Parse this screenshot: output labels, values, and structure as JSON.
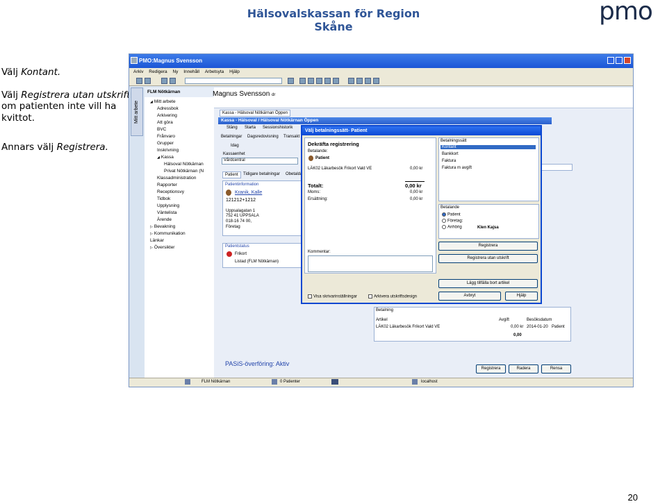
{
  "slide": {
    "title": "Hälsovalskassan för Region Skåne",
    "logo": "pmo",
    "page_number": "20",
    "instructions": {
      "line1_prefix": "Välj ",
      "line1_em": "Kontant.",
      "line2_prefix": "Välj ",
      "line2_em": "Registrera utan utskrift",
      "line3": "om patienten inte vill ha",
      "line4": "kvittot.",
      "line5_prefix": "Annars välj ",
      "line5_em": "Registrera."
    }
  },
  "app": {
    "title": "PMO:Magnus Svensson",
    "menu": [
      "Arkiv",
      "Redigera",
      "Ny",
      "Innehåll",
      "Arbetsyta",
      "Hjälp"
    ],
    "vertical_tab": "Mitt arbete",
    "tree_header": "FLM Nötkärnan",
    "user_name": "Magnus Svensson",
    "user_title": "dr",
    "tree": [
      {
        "label": "Mitt arbete",
        "indent": 0,
        "arrow": "◢"
      },
      {
        "label": "Adressbok",
        "indent": 1
      },
      {
        "label": "Arkivering",
        "indent": 1
      },
      {
        "label": "Att göra",
        "indent": 1
      },
      {
        "label": "BVC",
        "indent": 1
      },
      {
        "label": "Frånvaro",
        "indent": 1
      },
      {
        "label": "Grupper",
        "indent": 1
      },
      {
        "label": "Inskrivning",
        "indent": 1
      },
      {
        "label": "Kassa",
        "indent": 1,
        "arrow": "◢"
      },
      {
        "label": "Hälsoval Nötkärnan",
        "indent": 2
      },
      {
        "label": "Privat Nötkärnan (N",
        "indent": 2
      },
      {
        "label": "Klassadministration",
        "indent": 1
      },
      {
        "label": "Rapporter",
        "indent": 1
      },
      {
        "label": "Receptionsvy",
        "indent": 1
      },
      {
        "label": "Tidbok",
        "indent": 1
      },
      {
        "label": "Upplysning",
        "indent": 1
      },
      {
        "label": "Väntelista",
        "indent": 1
      },
      {
        "label": "Ärende",
        "indent": 1
      },
      {
        "label": "Bevakning",
        "indent": 0,
        "arrow": "▷"
      },
      {
        "label": "Kommunikation",
        "indent": 0,
        "arrow": "▷"
      },
      {
        "label": "Länkar",
        "indent": 0
      },
      {
        "label": "Översikter",
        "indent": 0,
        "arrow": "▷"
      }
    ],
    "kassa": {
      "tab_label": "Kassa - Hälsoval Nötkärnan Öppen",
      "panel_title": "Kassa - Hälsoval / Hälsoval Nötkärnan Öppen",
      "subtabs": [
        "Stäng",
        "Starta",
        "Sessionshistorik"
      ],
      "sections": [
        "Betalningar",
        "Dagsredovisning",
        "Transakt"
      ],
      "today": "Idag",
      "kassaenhet_label": "Kassaenhet",
      "kassaenhet_value": "Vårdcentral",
      "patient_tabs": [
        "Patient",
        "Tidigare betalningar",
        "Obetalda"
      ],
      "patientinfo_title": "Patientinformation",
      "patient_name": "Kranik, Kalle",
      "patient_id": "121212+1212",
      "address1": "Uppsalagatan 1",
      "address2": "752 41      UPPSALA",
      "phone": "018-16 74 00,",
      "company": "Företag",
      "status_title": "Patientstatus",
      "status1": "Frikort",
      "status2": "Listad (FLM Nötkärnan)",
      "betalning_title": "Betalning",
      "table_headers": [
        "Artikel",
        "Avgift",
        "Besöksdatum"
      ],
      "table_row": [
        "LÄK02 Läkarbesök Frikort Vald VE",
        "0,00 kr",
        "2014-01-20",
        "Patient"
      ],
      "table_total": "0,00",
      "pasis": "PASiS-överföring: Aktiv",
      "bottom_buttons": [
        "Registrera",
        "Radera",
        "Rensa"
      ]
    },
    "dialog": {
      "title": "Välj betalningssätt- Patient",
      "heading": "Dekräfta registrering",
      "betalande_label": "Betalande:",
      "betalande_value": "Patient",
      "article": "LÄK02 Läkarbesök Frikort Vald VE",
      "article_amount": "0,00 kr",
      "totalt_label": "Totalt:",
      "totalt_value": "0,00 kr",
      "moms_label": "Moms:",
      "moms_value": "0,00 kr",
      "ersattning_label": "Ersättning:",
      "ersattning_value": "0,00 kr",
      "comment_label": "Kommentar:",
      "betalningssatt_title": "Betalningssätt",
      "betalningssatt": [
        "Kontant",
        "Bankkort",
        "Faktura",
        "Faktura m avgift"
      ],
      "betalande_group_title": "Betalande",
      "betalande_options": [
        "Patient",
        "Företag:",
        "Anhörig"
      ],
      "anhorig_name": "Klen Kajsa",
      "btn_registrera": "Registrera",
      "btn_registrera_utan": "Registrera utan utskrift",
      "btn_lagg_till": "Lägg tillfälla bort artikel",
      "btn_avbryt": "Avbryt",
      "btn_hjalp": "Hjälp",
      "check_visa": "Visa skrivarinställningar",
      "check_arkivera": "Arkivera utskriftsdesign"
    },
    "status": {
      "unit": "FLM Nötkärnan",
      "patients": "0 Patienter",
      "host": "localhost"
    }
  }
}
